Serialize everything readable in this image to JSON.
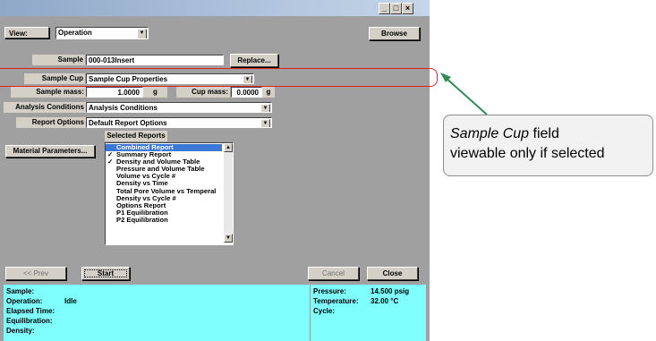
{
  "window": {
    "title": "",
    "controls": {
      "minimize": "_",
      "maximize": "□",
      "close": "×"
    }
  },
  "toolbar": {
    "view_label": "View:",
    "view_value": "Operation",
    "browse_label": "Browse"
  },
  "form": {
    "sample_label": "Sample",
    "sample_value": "000-013Insert",
    "replace_label": "Replace...",
    "sample_cup_label": "Sample Cup",
    "sample_cup_value": "Sample Cup Properties",
    "sample_mass_label": "Sample mass:",
    "sample_mass_value": "1.0000",
    "sample_mass_unit": "g",
    "cup_mass_label": "Cup mass:",
    "cup_mass_value": "0.0000",
    "cup_mass_unit": "g",
    "analysis_label": "Analysis Conditions",
    "analysis_value": "Analysis Conditions",
    "report_label": "Report Options",
    "report_value": "Default Report Options",
    "selected_reports_label": "Selected Reports",
    "material_button_label": "Material Parameters..."
  },
  "reports": [
    {
      "label": "Combined Report",
      "checked": false,
      "selected": true
    },
    {
      "label": "Summary Report",
      "checked": true,
      "selected": false
    },
    {
      "label": "Density and Volume Table",
      "checked": true,
      "selected": false
    },
    {
      "label": "Pressure and Volume Table",
      "checked": false,
      "selected": false
    },
    {
      "label": "Volume vs Cycle #",
      "checked": false,
      "selected": false
    },
    {
      "label": "Density vs Time",
      "checked": false,
      "selected": false
    },
    {
      "label": "Total Pore Volume vs Temperal",
      "checked": false,
      "selected": false
    },
    {
      "label": "Density vs Cycle #",
      "checked": false,
      "selected": false
    },
    {
      "label": "Options Report",
      "checked": false,
      "selected": false
    },
    {
      "label": "P1 Equilibration",
      "checked": false,
      "selected": false
    },
    {
      "label": "P2 Equilibration",
      "checked": false,
      "selected": false
    }
  ],
  "nav": {
    "prev_label": "<< Prev",
    "start_label": "Start",
    "cancel_label": "Cancel",
    "close_label": "Close"
  },
  "status": {
    "sample_label": "Sample:",
    "operation_label": "Operation:",
    "operation_value": "Idle",
    "elapsed_label": "Elapsed Time:",
    "equilibration_label": "Equilibration:",
    "density_label": "Density:",
    "pressure_label": "Pressure:",
    "pressure_value": "14.500 psig",
    "temperature_label": "Temperature:",
    "temperature_value": "32.00 °C",
    "cycle_label": "Cycle:"
  },
  "callout": {
    "text_italic": "Sample Cup",
    "text_rest_line1": " field",
    "text_line2": "viewable only if selected",
    "highlight_color": "#e02020",
    "arrow_color": "#2e8b57"
  }
}
